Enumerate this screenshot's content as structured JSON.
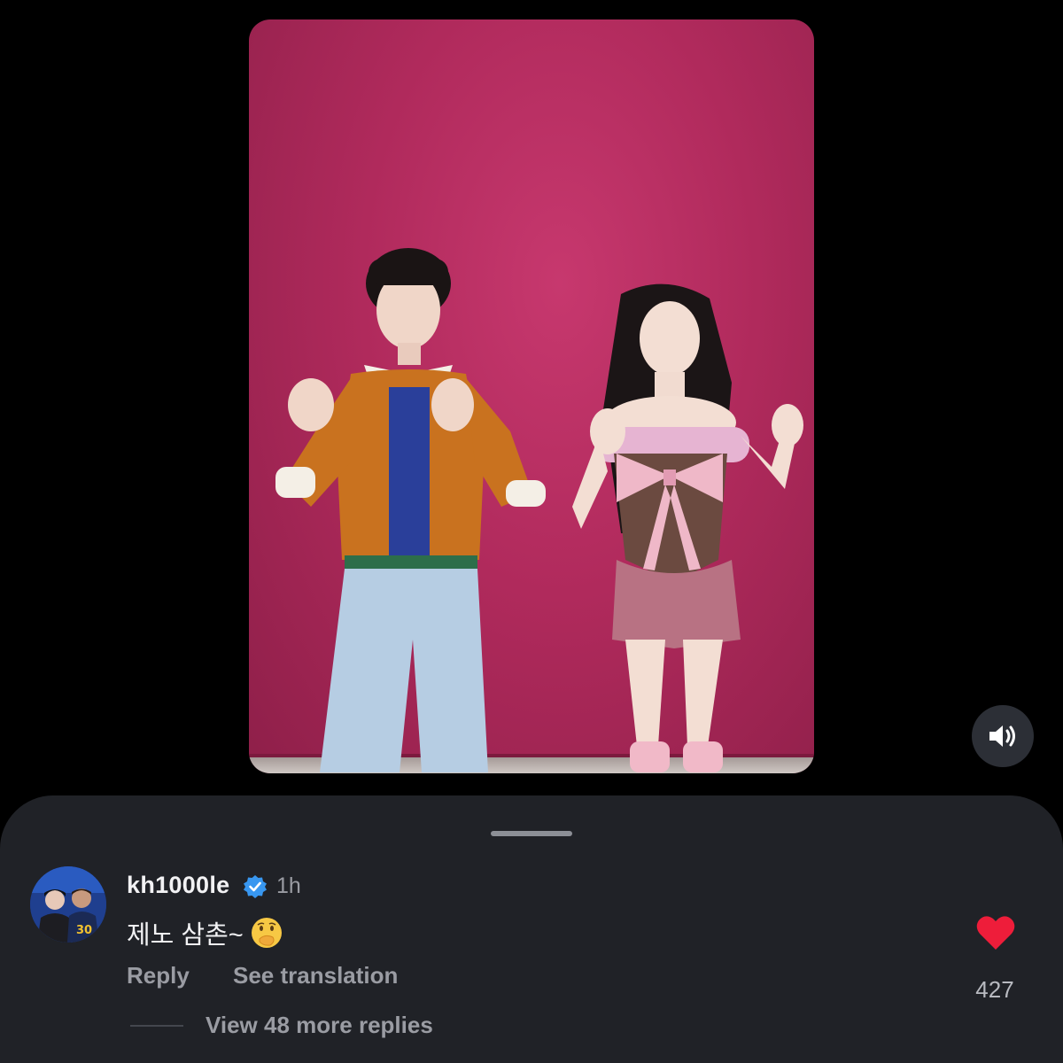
{
  "video": {
    "description_icon": "video-frame",
    "sound_icon": "speaker-icon"
  },
  "comment": {
    "username": "kh1000le",
    "verified_icon": "verified-badge-icon",
    "time": "1h",
    "text": "제노 삼촌~",
    "emoji": "face-with-hand-over-mouth-emoji",
    "reply_label": "Reply",
    "translate_label": "See translation",
    "like_icon": "heart-icon",
    "like_count": "427",
    "view_replies_label": "View 48 more replies"
  },
  "colors": {
    "accent_like": "#ee1d3a",
    "verified_blue": "#3897f0",
    "sheet_bg": "#202227",
    "video_bg": "#b02a5c"
  }
}
